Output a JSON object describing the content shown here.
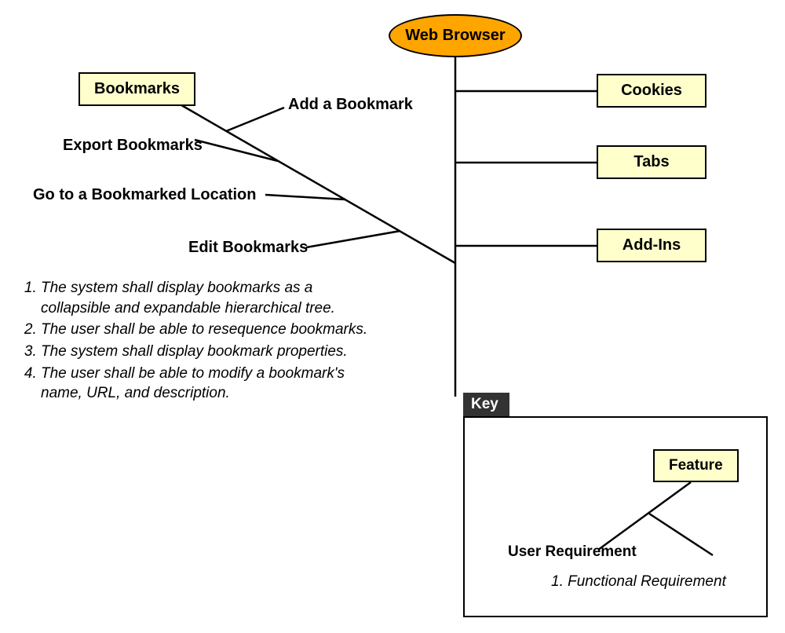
{
  "root": {
    "label": "Web Browser"
  },
  "features": {
    "bookmarks": "Bookmarks",
    "cookies": "Cookies",
    "tabs": "Tabs",
    "addins": "Add-Ins"
  },
  "branches": {
    "add": "Add a Bookmark",
    "export": "Export Bookmarks",
    "go": "Go to a Bookmarked Location",
    "edit": "Edit Bookmarks"
  },
  "requirements": [
    "The system shall display bookmarks as a collapsible and expandable hierarchical tree.",
    "The user shall be able to resequence bookmarks.",
    "The system shall display bookmark properties.",
    "The user shall be able to modify a bookmark's name, URL, and description."
  ],
  "key": {
    "title": "Key",
    "feature": "Feature",
    "user_req": "User Requirement",
    "func_req": "1. Functional Requirement"
  }
}
